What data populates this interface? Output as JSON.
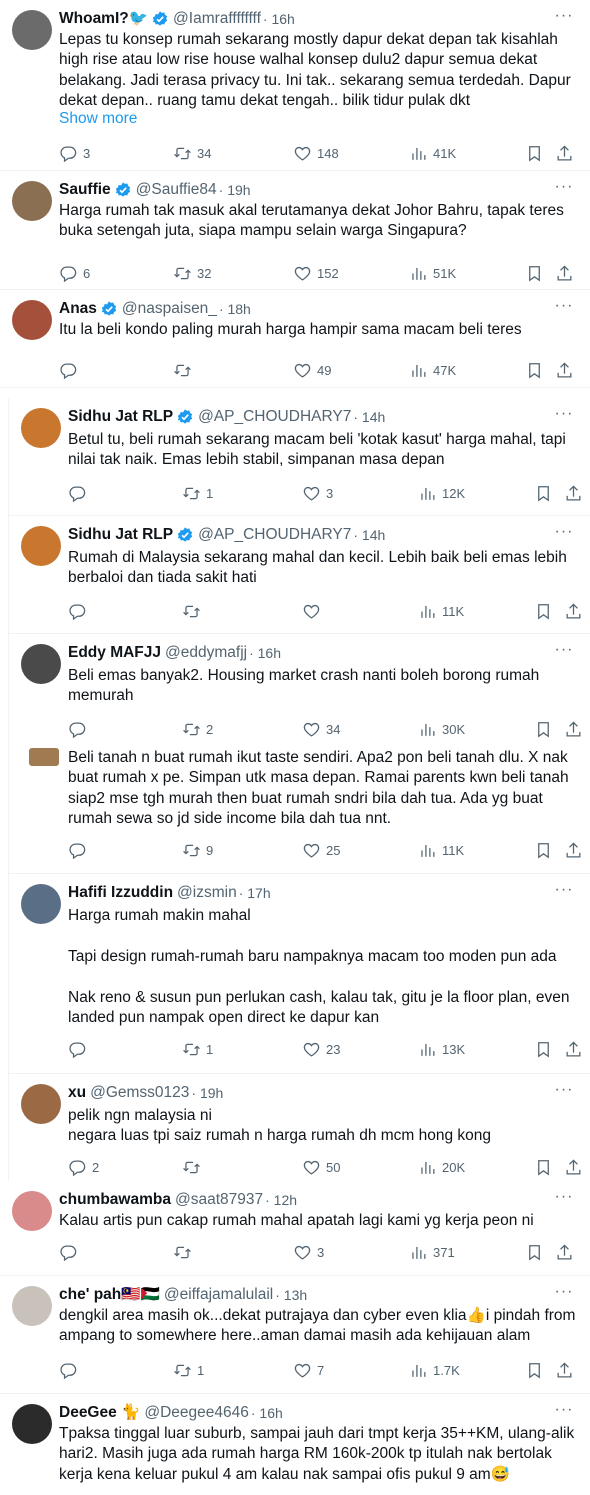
{
  "tweets": [
    {
      "name": "WhoamI?🐦",
      "handle": "@Iamraffffffff",
      "time": "· 16h",
      "verified": true,
      "text": "Lepas tu konsep rumah sekarang mostly dapur dekat depan tak kisahlah high rise atau low rise house walhal konsep dulu2 dapur semua dekat belakang. Jadi terasa privacy tu. Ini tak.. sekarang semua terdedah. Dapur dekat depan.. ruang tamu dekat tengah.. bilik tidur pulak dkt",
      "show_more": "Show more",
      "replies": "3",
      "retweets": "34",
      "likes": "148",
      "views": "41K"
    },
    {
      "name": "Sauffie",
      "handle": "@Sauffie84",
      "time": "· 19h",
      "verified": true,
      "text": "Harga rumah tak masuk akal terutamanya dekat Johor Bahru, tapak teres buka setengah juta, siapa mampu selain warga Singapura?",
      "replies": "6",
      "retweets": "32",
      "likes": "152",
      "views": "51K"
    },
    {
      "name": "Anas",
      "handle": "@naspaisen_",
      "time": "· 18h",
      "verified": true,
      "text": "Itu la beli kondo paling murah harga hampir sama macam beli teres",
      "replies": "",
      "retweets": "",
      "likes": "49",
      "views": "47K"
    },
    {
      "name": "Sidhu Jat RLP",
      "handle": "@AP_CHOUDHARY7",
      "time": "· 14h",
      "verified": true,
      "text": "Betul tu, beli rumah sekarang macam beli 'kotak kasut' harga mahal, tapi nilai tak naik. Emas lebih stabil, simpanan masa depan",
      "replies": "",
      "retweets": "1",
      "likes": "3",
      "views": "12K"
    },
    {
      "name": "Sidhu Jat RLP",
      "handle": "@AP_CHOUDHARY7",
      "time": "· 14h",
      "verified": true,
      "text": "Rumah di Malaysia sekarang mahal dan kecil. Lebih baik beli emas lebih berbaloi dan tiada sakit hati",
      "replies": "",
      "retweets": "",
      "likes": "",
      "views": "11K"
    },
    {
      "name": "Eddy MAFJJ",
      "handle": "@eddymafjj",
      "time": "· 16h",
      "verified": false,
      "text": "Beli emas banyak2. Housing market crash nanti boleh borong rumah memurah",
      "replies": "",
      "retweets": "2",
      "likes": "34",
      "views": "30K"
    },
    {
      "name": "",
      "handle": "",
      "time": "",
      "verified": false,
      "text": "Beli tanah n buat rumah ikut taste sendiri. Apa2 pon beli tanah dlu. X nak buat rumah x pe. Simpan utk masa depan. Ramai parents kwn beli tanah siap2 mse tgh murah then buat rumah sndri bila dah tua. Ada yg buat rumah sewa so jd side income bila dah tua nnt.",
      "replies": "",
      "retweets": "9",
      "likes": "25",
      "views": "11K"
    },
    {
      "name": "Hafifi Izzuddin",
      "handle": "@izsmin",
      "time": "· 17h",
      "verified": false,
      "text": "Harga rumah makin mahal\n\nTapi design rumah-rumah baru nampaknya macam too moden pun ada\n\nNak reno & susun pun perlukan cash, kalau tak, gitu je la floor plan, even landed pun nampak open direct ke dapur kan",
      "replies": "",
      "retweets": "1",
      "likes": "23",
      "views": "13K"
    },
    {
      "name": "xu",
      "handle": "@Gemss0123",
      "time": "· 19h",
      "verified": false,
      "text": "pelik ngn malaysia ni\nnegara luas tpi saiz rumah n harga rumah dh mcm hong kong",
      "replies": "2",
      "retweets": "",
      "likes": "50",
      "views": "20K"
    },
    {
      "name": "chumbawamba",
      "handle": "@saat87937",
      "time": "· 12h",
      "verified": false,
      "text": "Kalau artis pun cakap rumah mahal apatah lagi kami yg kerja peon ni",
      "replies": "",
      "retweets": "",
      "likes": "3",
      "views": "371"
    },
    {
      "name": "che' pah🇲🇾🇵🇸",
      "handle": "@eiffajamalulail",
      "time": "· 13h",
      "verified": false,
      "text": "dengkil area masih ok...dekat putrajaya dan cyber even klia👍i pindah from ampang to somewhere here..aman damai masih ada kehijauan alam",
      "replies": "",
      "retweets": "1",
      "likes": "7",
      "views": "1.7K"
    },
    {
      "name": "DeeGee 🐈",
      "handle": "@Deegee4646",
      "time": "· 16h",
      "verified": false,
      "text": "Tpaksa tinggal luar suburb, sampai jauh dari tmpt kerja 35++KM, ulang-alik hari2. Masih juga ada rumah harga RM 160k-200k tp itulah nak bertolak kerja kena keluar pukul 4 am kalau nak sampai ofis pukul 9 am😅",
      "replies": "",
      "retweets": "",
      "likes": "",
      "views": ""
    }
  ],
  "icons": {
    "reply": "reply-icon",
    "retweet": "retweet-icon",
    "like": "heart-icon",
    "views": "views-icon",
    "bookmark": "bookmark-icon",
    "share": "share-icon",
    "more": "more-icon",
    "verified": "verified-badge-icon"
  },
  "colors": {
    "link": "#1d9bf0",
    "muted": "#536471",
    "text": "#0f1419",
    "verified": "#1d9bf0"
  }
}
